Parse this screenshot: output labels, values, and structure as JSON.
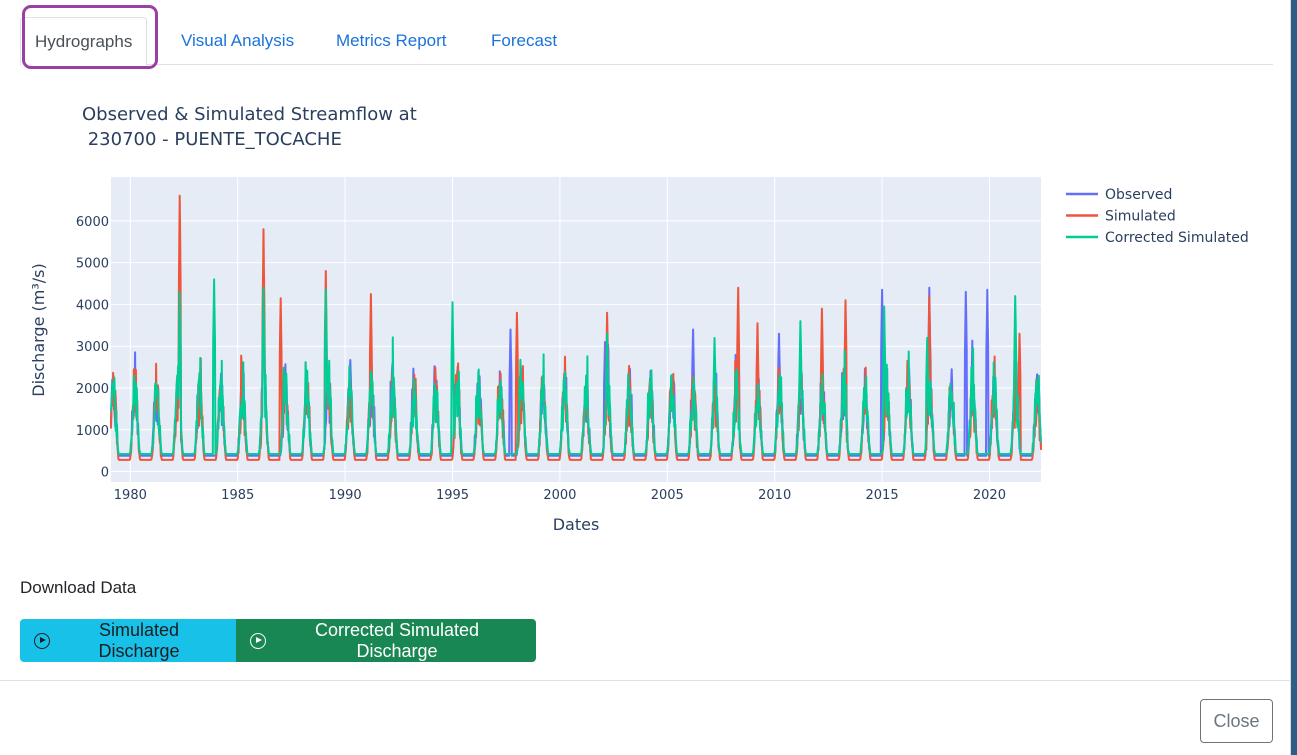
{
  "tabs": [
    {
      "label": "Hydrographs",
      "active": true
    },
    {
      "label": "Visual Analysis",
      "active": false
    },
    {
      "label": "Metrics Report",
      "active": false
    },
    {
      "label": "Forecast",
      "active": false
    }
  ],
  "colors": {
    "observed": "#636efa",
    "simulated": "#ef553b",
    "corrected": "#00cc96",
    "highlight": "#9b3fa5",
    "btn_simulated": "#17c1e8",
    "btn_corrected": "#198754"
  },
  "chart_data": {
    "type": "line",
    "title_line1": "Observed & Simulated Streamflow at",
    "title_line2": " 230700 - PUENTE_TOCACHE",
    "xlabel": "Dates",
    "ylabel": "Discharge (m³/s)",
    "xlim": [
      1979.1,
      2022.4
    ],
    "ylim": [
      -250,
      7050
    ],
    "x_ticks": [
      "1980",
      "1985",
      "1990",
      "1995",
      "2000",
      "2005",
      "2010",
      "2015",
      "2020"
    ],
    "y_ticks": [
      "0",
      "1000",
      "2000",
      "3000",
      "4000",
      "5000",
      "6000"
    ],
    "legend": [
      "Observed",
      "Simulated",
      "Corrected Simulated"
    ],
    "series": [
      {
        "name": "Observed",
        "peaks": [
          [
            1982.3,
            4300
          ],
          [
            1986.2,
            4700
          ],
          [
            1997.7,
            3400
          ],
          [
            2002.1,
            3100
          ],
          [
            2006.2,
            3400
          ],
          [
            2008.3,
            3600
          ],
          [
            2010.2,
            3300
          ],
          [
            2015.0,
            4350
          ],
          [
            2017.2,
            4400
          ],
          [
            2018.9,
            4300
          ],
          [
            2019.9,
            4350
          ]
        ]
      },
      {
        "name": "Simulated",
        "peaks": [
          [
            1982.3,
            6600
          ],
          [
            1986.2,
            5800
          ],
          [
            1987.0,
            4150
          ],
          [
            1989.1,
            4800
          ],
          [
            1991.2,
            4250
          ],
          [
            1998.0,
            3800
          ],
          [
            2002.2,
            3800
          ],
          [
            2008.3,
            4400
          ],
          [
            2009.2,
            3550
          ],
          [
            2012.2,
            3900
          ],
          [
            2013.3,
            4100
          ],
          [
            2017.2,
            4200
          ],
          [
            2021.4,
            3300
          ]
        ]
      },
      {
        "name": "Corrected Simulated",
        "peaks": [
          [
            1982.3,
            4300
          ],
          [
            1983.9,
            4600
          ],
          [
            1986.2,
            4400
          ],
          [
            1989.1,
            4350
          ],
          [
            1995.0,
            4050
          ],
          [
            2002.2,
            3300
          ],
          [
            2007.2,
            3200
          ],
          [
            2011.2,
            3600
          ],
          [
            2015.1,
            3950
          ],
          [
            2017.1,
            3200
          ],
          [
            2021.2,
            4200
          ]
        ]
      }
    ]
  },
  "download": {
    "label": "Download Data",
    "simulated_btn": "Simulated Discharge",
    "corrected_btn": "Corrected Simulated Discharge"
  },
  "footer": {
    "close_label": "Close"
  }
}
